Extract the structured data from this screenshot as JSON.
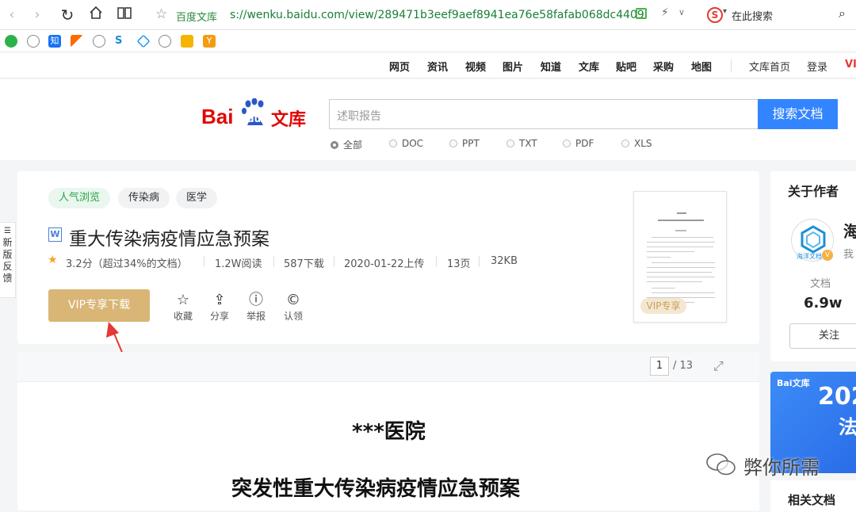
{
  "browser": {
    "site_name": "百度文库",
    "url": "s://wenku.baidu.com/view/289471b3eef9aef8941ea76e58fafab068dc4409",
    "search_placeholder": "在此搜索"
  },
  "topnav": {
    "links": [
      "网页",
      "资讯",
      "视频",
      "图片",
      "知道",
      "文库",
      "贴吧",
      "采购",
      "地图"
    ],
    "right": [
      "文库首页",
      "登录",
      "VI"
    ]
  },
  "search": {
    "logo_bai": "Bai",
    "logo_du": "du",
    "logo_wenku": "文库",
    "placeholder": "述职报告",
    "button": "搜索文档",
    "filters": [
      "全部",
      "DOC",
      "PPT",
      "TXT",
      "PDF",
      "XLS"
    ]
  },
  "doc": {
    "tags": [
      "人气浏览",
      "传染病",
      "医学"
    ],
    "title": "重大传染病疫情应急预案",
    "rating": "3.2分（超过34%的文档）",
    "reads": "1.2W阅读",
    "downloads": "587下载",
    "upload": "2020-01-22上传",
    "pages": "13页",
    "size": "32KB",
    "download_button": "VIP专享下载",
    "actions": [
      "收藏",
      "分享",
      "举报",
      "认领"
    ],
    "thumb_badge": "VIP专享",
    "page_current": "1",
    "page_total": "/ 13",
    "heading1": "***医院",
    "heading2": "突发性重大传染病疫情应急预案"
  },
  "feedback": "新版反馈",
  "author": {
    "section": "关于作者",
    "name_partial": "海",
    "sub_partial": "我",
    "avatar_label": "海洋文档",
    "docs_label": "文档",
    "docs_count": "6.9w",
    "follow": "关注",
    "banner_logo": "Bai文库",
    "banner_year": "202",
    "banner_text": "法",
    "related": "相关文档"
  },
  "watermark": "弊你所需"
}
